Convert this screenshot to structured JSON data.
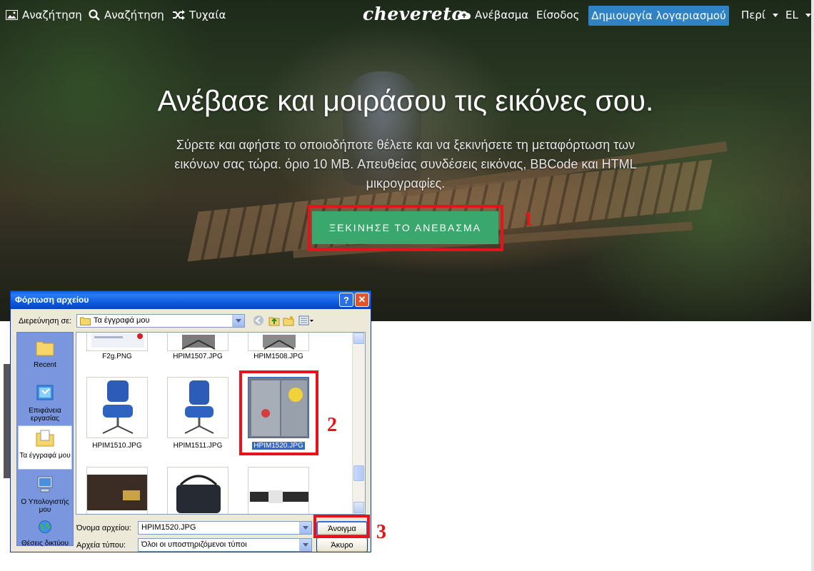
{
  "nav": {
    "images_label": "Αναζήτηση",
    "search_label": "Αναζήτηση",
    "random_label": "Τυχαία",
    "logo": "chevereto",
    "upload_label": "Ανέβασμα",
    "login_label": "Είσοδος",
    "signup_label": "Δημιουργία λογαριασμού",
    "about_label": "Περί",
    "lang_label": "EL"
  },
  "hero": {
    "title": "Ανέβασε και μοιράσου τις εικόνες σου.",
    "subtitle": "Σύρετε και αφήστε το οποιοδήποτε θέλετε και να ξεκινήσετε τη μεταφόρτωση των εικόνων σας τώρα. όριο 10 MB. Απευθείας συνδέσεις εικόνας, BBCode και HTML μικρογραφίες.",
    "start_button": "ΞΕΚΙΝΗΣΕ ΤΟ ΑΝΕΒΑΣΜΑ"
  },
  "annotations": {
    "step1": "1",
    "step2": "2",
    "step3": "3",
    "color": "#e8131a"
  },
  "dialog": {
    "title": "Φόρτωση αρχείου",
    "help_btn": "?",
    "close_btn": "✕",
    "look_in_label": "Διερεύνηση σε:",
    "look_in_value": "Τα έγγραφά μου",
    "places": [
      {
        "label": "Recent"
      },
      {
        "label": "Επιφάνεια εργασίας"
      },
      {
        "label": "Τα έγγραφά μου"
      },
      {
        "label": "Ο Υπολογιστής μου"
      },
      {
        "label": "Θέσεις δικτύου"
      }
    ],
    "files": [
      {
        "name": "F2g.PNG"
      },
      {
        "name": "HPIM1507.JPG"
      },
      {
        "name": "HPIM1508.JPG"
      },
      {
        "name": "HPIM1510.JPG"
      },
      {
        "name": "HPIM1511.JPG"
      },
      {
        "name": "HPIM1520.JPG"
      }
    ],
    "filename_label": "Όνομα αρχείου:",
    "filename_value": "HPIM1520.JPG",
    "filetype_label": "Αρχεία τύπου:",
    "filetype_value": "Όλοι οι υποστηριζόμενοι τύποι",
    "open_btn": "Άνοιγμα",
    "cancel_btn": "Άκυρο"
  }
}
